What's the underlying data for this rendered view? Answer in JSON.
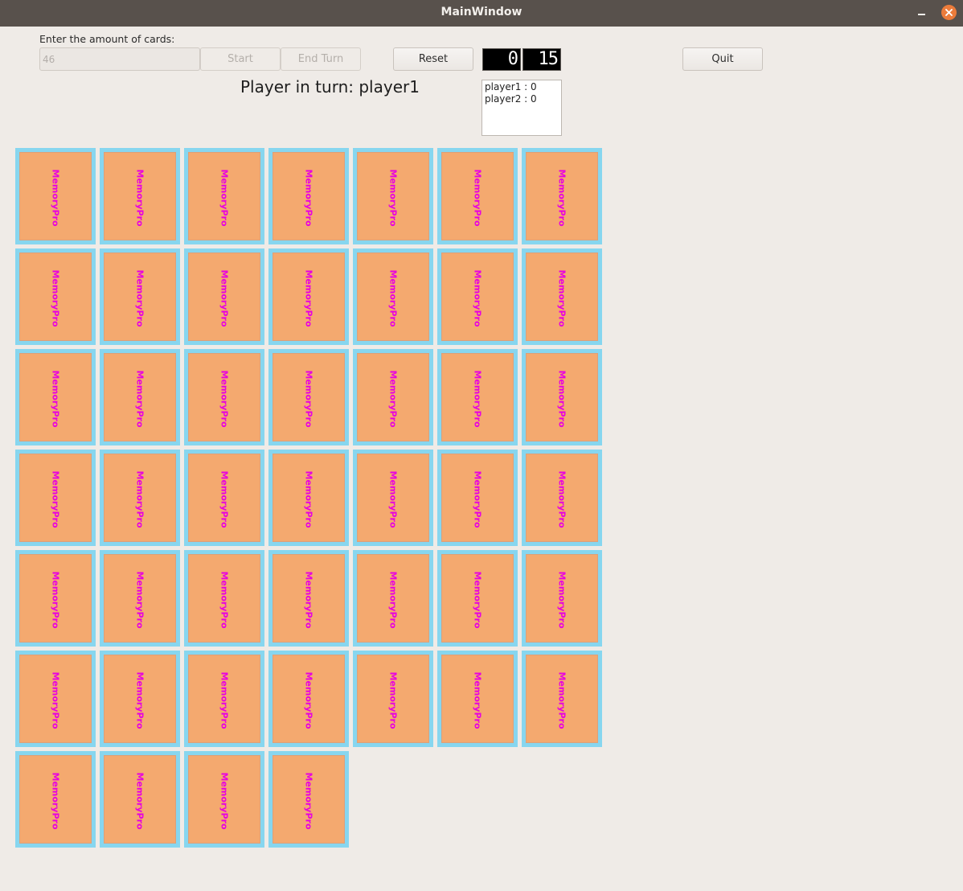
{
  "window": {
    "title": "MainWindow"
  },
  "controls": {
    "amount_label": "Enter the amount of cards:",
    "amount_value": "46",
    "start_label": "Start",
    "end_turn_label": "End Turn",
    "reset_label": "Reset",
    "quit_label": "Quit"
  },
  "lcd": {
    "display1": "0",
    "display2": "15"
  },
  "turn": {
    "text": "Player in turn: player1"
  },
  "scores": [
    "player1 : 0",
    "player2 : 0"
  ],
  "cards": {
    "count": 46,
    "columns": 7,
    "back_text": "MemoryPro",
    "colors": {
      "frame": "#87d6ef",
      "face": "#f4a96f",
      "text": "#e800e0"
    }
  }
}
